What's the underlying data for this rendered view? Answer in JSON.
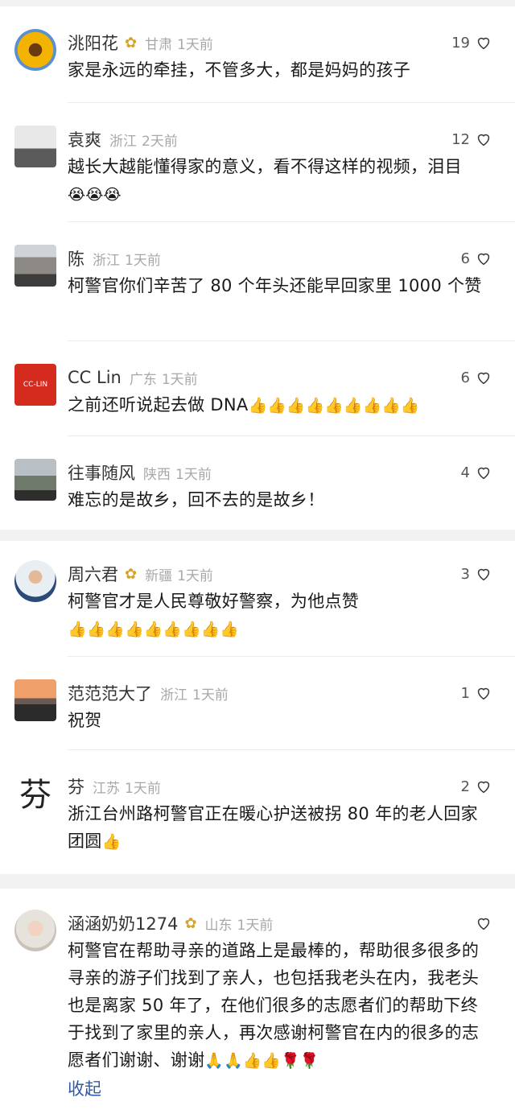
{
  "comments": [
    {
      "name": "洮阳花",
      "badge": "✿",
      "location": "甘肃",
      "time": "1天前",
      "likes": "19",
      "text": "家是永远的牵挂，不管多大，都是妈妈的孩子",
      "emojis": ""
    },
    {
      "name": "袁爽",
      "location": "浙江",
      "time": "2天前",
      "likes": "12",
      "text": "越长大越能懂得家的意义，看不得这样的视频，泪目",
      "emojis": "😭😭😭"
    },
    {
      "name": "陈",
      "location": "浙江",
      "time": "1天前",
      "likes": "6",
      "text": "柯警官你们辛苦了 80 个年头还能早回家里 1000 个赞",
      "emojis": ""
    },
    {
      "name": "CC Lin",
      "location": "广东",
      "time": "1天前",
      "likes": "6",
      "text": "之前还听说起去做 DNA",
      "emojis": "👍👍👍👍👍👍👍👍👍",
      "avatar_text": "CC-LIN"
    },
    {
      "name": "往事随风",
      "location": "陕西",
      "time": "1天前",
      "likes": "4",
      "text": "难忘的是故乡，回不去的是故乡！",
      "emojis": ""
    },
    {
      "name": "周六君",
      "badge": "✿",
      "location": "新疆",
      "time": "1天前",
      "likes": "3",
      "text": "柯警官才是人民尊敬好警察，为他点赞",
      "emojis": "👍👍👍👍👍👍👍👍👍"
    },
    {
      "name": "范范范大了",
      "location": "浙江",
      "time": "1天前",
      "likes": "1",
      "text": "祝贺",
      "emojis": ""
    },
    {
      "name": "芬",
      "location": "江苏",
      "time": "1天前",
      "likes": "2",
      "text": "浙江台州路柯警官正在暖心护送被拐 80 年的老人回家团圆",
      "emojis": "👍",
      "avatar_text": "芬"
    },
    {
      "name": "涵涵奶奶1274",
      "badge": "✿",
      "location": "山东",
      "time": "1天前",
      "likes": "",
      "text": "柯警官在帮助寻亲的道路上是最棒的，帮助很多很多的寻亲的游子们找到了亲人，也包括我老头在内，我老头也是离家 50 年了，在他们很多的志愿者们的帮助下终于找到了家里的亲人，再次感谢柯警官在内的很多的志愿者们谢谢、谢谢",
      "emojis": "🙏🙏👍👍🌹🌹",
      "collapse_label": "收起"
    }
  ],
  "icons": {
    "like": "heart-outline-icon",
    "badge": "flower-badge-icon"
  },
  "colors": {
    "badge": "#d6a227",
    "link": "#2f5aa8",
    "meta": "#a8a8a8"
  }
}
